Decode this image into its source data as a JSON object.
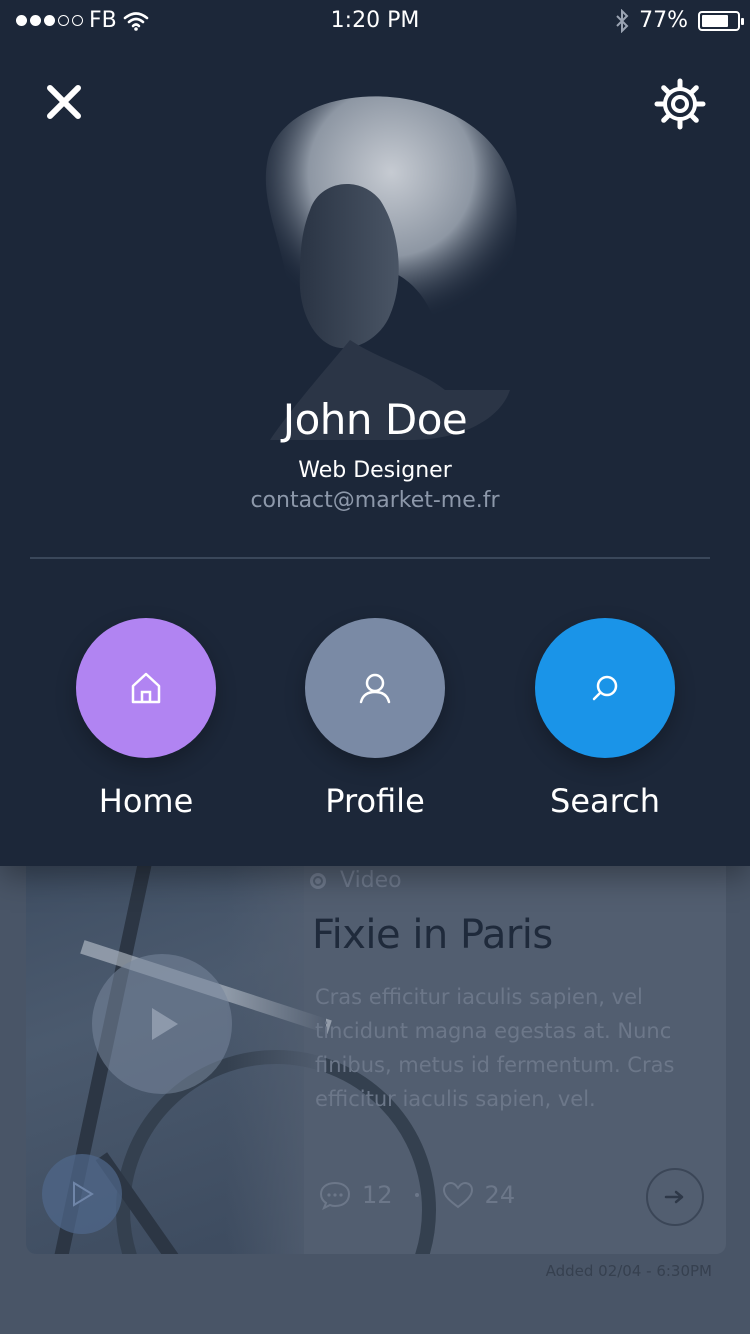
{
  "status_bar": {
    "carrier": "FB",
    "time": "1:20 PM",
    "battery": "77%",
    "battery_level": 0.77
  },
  "drawer": {
    "profile": {
      "name": "John Doe",
      "role": "Web Designer",
      "email": "contact@market-me.fr"
    },
    "nav": [
      {
        "label": "Home",
        "icon": "home-icon",
        "color": "#b184f2"
      },
      {
        "label": "Profile",
        "icon": "user-icon",
        "color": "#7a8aa5"
      },
      {
        "label": "Search",
        "icon": "search-icon",
        "color": "#1a94e8"
      }
    ]
  },
  "card": {
    "type": "Video",
    "title": "Fixie in Paris",
    "text": "Cras efficitur iaculis sapien, vel tincidunt magna egestas at. Nunc finibus, metus id fermentum. Cras efficitur iaculis sapien, vel.",
    "comments": "12",
    "likes": "24",
    "date": "Added 02/04 - 6:30PM"
  },
  "colors": {
    "drawer_bg": "#1c2739",
    "page_bg": "#495567",
    "home": "#b184f2",
    "profile": "#7a8aa5",
    "search": "#1a94e8"
  }
}
